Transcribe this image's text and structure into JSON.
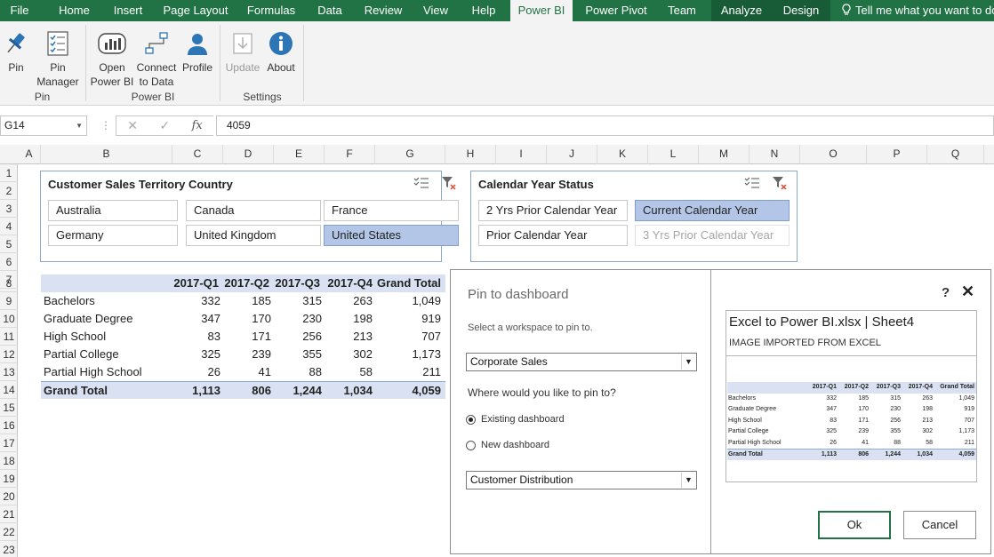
{
  "tabs": [
    {
      "label": "File"
    },
    {
      "label": "Home"
    },
    {
      "label": "Insert"
    },
    {
      "label": "Page Layout"
    },
    {
      "label": "Formulas"
    },
    {
      "label": "Data"
    },
    {
      "label": "Review"
    },
    {
      "label": "View"
    },
    {
      "label": "Help"
    },
    {
      "label": "Power BI"
    },
    {
      "label": "Power Pivot"
    },
    {
      "label": "Team"
    },
    {
      "label": "Analyze"
    },
    {
      "label": "Design"
    }
  ],
  "tell_me": "Tell me what you want to do",
  "ribbon": {
    "pin": "Pin",
    "pin_manager_1": "Pin",
    "pin_manager_2": "Manager",
    "open_1": "Open",
    "open_2": "Power BI",
    "connect_1": "Connect",
    "connect_2": "to Data",
    "profile": "Profile",
    "update": "Update",
    "about": "About",
    "group_pin": "Pin",
    "group_powerbi": "Power BI",
    "group_settings": "Settings"
  },
  "formula_bar": {
    "name_box": "G14",
    "value": "4059"
  },
  "columns": [
    "A",
    "B",
    "C",
    "D",
    "E",
    "F",
    "G",
    "H",
    "I",
    "J",
    "K",
    "L",
    "M",
    "N",
    "O",
    "P",
    "Q"
  ],
  "rows": [
    "1",
    "2",
    "3",
    "4",
    "5",
    "6",
    "7",
    "8",
    "9",
    "10",
    "11",
    "12",
    "13",
    "14",
    "15",
    "16",
    "17",
    "18",
    "19",
    "20",
    "21",
    "22",
    "23"
  ],
  "slicer_country": {
    "title": "Customer Sales Territory Country",
    "items": [
      "Australia",
      "Canada",
      "France",
      "Germany",
      "United Kingdom",
      "United States"
    ],
    "selected": "United States"
  },
  "slicer_calendar": {
    "title": "Calendar Year Status",
    "items": [
      "2 Yrs Prior Calendar Year",
      "Current Calendar Year",
      "Prior Calendar Year",
      "3 Yrs Prior Calendar Year"
    ],
    "selected": "Current Calendar Year",
    "disabled": "3 Yrs Prior Calendar Year"
  },
  "pivot": {
    "headers": [
      "2017-Q1",
      "2017-Q2",
      "2017-Q3",
      "2017-Q4",
      "Grand Total"
    ],
    "rows": [
      {
        "label": "Bachelors",
        "values": [
          "332",
          "185",
          "315",
          "263",
          "1,049"
        ]
      },
      {
        "label": "Graduate Degree",
        "values": [
          "347",
          "170",
          "230",
          "198",
          "919"
        ]
      },
      {
        "label": "High School",
        "values": [
          "83",
          "171",
          "256",
          "213",
          "707"
        ]
      },
      {
        "label": "Partial College",
        "values": [
          "325",
          "239",
          "355",
          "302",
          "1,173"
        ]
      },
      {
        "label": "Partial High School",
        "values": [
          "26",
          "41",
          "88",
          "58",
          "211"
        ]
      }
    ],
    "total": {
      "label": "Grand Total",
      "values": [
        "1,113",
        "806",
        "1,244",
        "1,034",
        "4,059"
      ]
    }
  },
  "dialog": {
    "title": "Pin to dashboard",
    "workspace_prompt": "Select a workspace to pin to.",
    "workspace_value": "Corporate Sales",
    "pin_question": "Where would you like to pin to?",
    "option_existing": "Existing dashboard",
    "option_new": "New dashboard",
    "dashboard_value": "Customer Distribution",
    "help": "?",
    "close": "✕",
    "preview_title": "Excel to Power BI.xlsx | Sheet4",
    "preview_subtitle": "IMAGE IMPORTED FROM EXCEL",
    "ok": "Ok",
    "cancel": "Cancel"
  },
  "colors": {
    "excel_green": "#217346",
    "slicer_selected": "#b4c6e7",
    "pivot_header": "#d9e1f2"
  }
}
